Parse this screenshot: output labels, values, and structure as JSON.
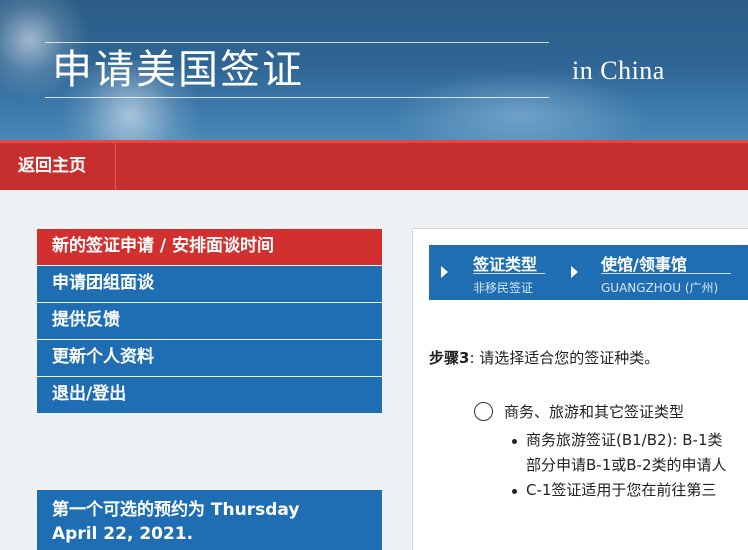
{
  "banner": {
    "title": "申请美国签证",
    "subtitle": "in China"
  },
  "navbar": {
    "home_label": "返回主页"
  },
  "menu": {
    "items": [
      {
        "label": "新的签证申请 / 安排面谈时间",
        "active": true
      },
      {
        "label": "申请团组面谈",
        "active": false
      },
      {
        "label": "提供反馈",
        "active": false
      },
      {
        "label": "更新个人资料",
        "active": false
      },
      {
        "label": "退出/登出",
        "active": false
      }
    ]
  },
  "appointment": {
    "line1": "第一个可选的预约为 Thursday",
    "line2": "April 22, 2021."
  },
  "steps": [
    {
      "label": "签证类型",
      "value": "非移民签证"
    },
    {
      "label": "使馆/领事馆",
      "value": "GUANGZHOU (广州)"
    }
  ],
  "instruction": {
    "step": "步骤3",
    "text": ": 请选择适合您的签证种类。"
  },
  "option": {
    "label": "商务、旅游和其它签证类型",
    "bullets": [
      {
        "text": "商务旅游签证(B1/B2): B-1类",
        "continuation": "部分申请B-1或B-2类的申请人"
      },
      {
        "text": "C-1签证适用于您在前往第三",
        "continuation": ""
      }
    ]
  },
  "colors": {
    "banner_blue": "#2f6594",
    "nav_red": "#c72f2f",
    "menu_blue": "#1f6eb3",
    "menu_active_red": "#d2302e"
  }
}
